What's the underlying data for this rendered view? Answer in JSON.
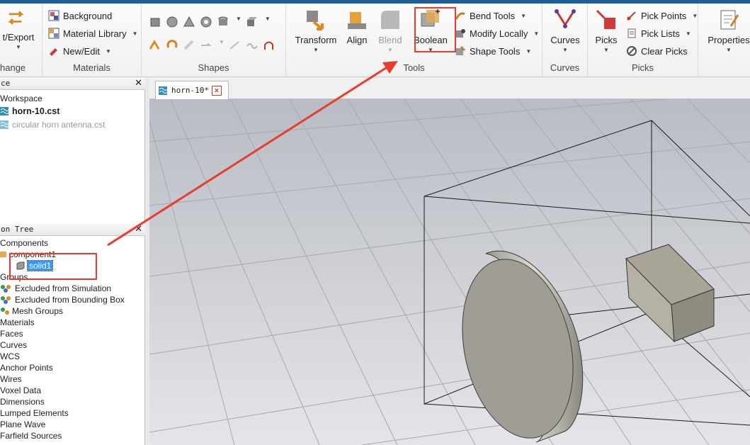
{
  "ribbon": {
    "change_group": {
      "import_export_label": "t/Export",
      "label": "hange"
    },
    "materials_group": {
      "label": "Materials",
      "items": [
        {
          "label": "Background",
          "icon": "background-icon"
        },
        {
          "label": "Material Library",
          "icon": "material-library-icon"
        },
        {
          "label": "New/Edit",
          "icon": "new-edit-icon"
        }
      ]
    },
    "shapes_group": {
      "label": "Shapes"
    },
    "tools_group": {
      "label": "Tools",
      "transform_label": "Transform",
      "align_label": "Align",
      "blend_label": "Blend",
      "boolean_label": "Boolean",
      "items": [
        {
          "label": "Bend Tools"
        },
        {
          "label": "Modify Locally"
        },
        {
          "label": "Shape Tools"
        }
      ]
    },
    "curves_group": {
      "label": "Curves",
      "curves_label": "Curves"
    },
    "picks_group": {
      "label": "Picks",
      "picks_label": "Picks",
      "items": [
        {
          "label": "Pick Points"
        },
        {
          "label": "Pick Lists"
        },
        {
          "label": "Clear Picks"
        }
      ]
    },
    "properties_label": "Properties"
  },
  "workspace_pane": {
    "header": "ce",
    "items": [
      {
        "label": "Workspace"
      },
      {
        "label": "horn-10.cst"
      },
      {
        "label": "circular horn antenna.cst"
      }
    ]
  },
  "navigation_tree": {
    "header": "on Tree",
    "items": [
      {
        "label": "Components"
      },
      {
        "label": "component1"
      },
      {
        "label": "solid1"
      },
      {
        "label": "Groups"
      },
      {
        "label": "Excluded from Simulation"
      },
      {
        "label": "Excluded from Bounding Box"
      },
      {
        "label": "Mesh Groups"
      },
      {
        "label": "Materials"
      },
      {
        "label": "Faces"
      },
      {
        "label": "Curves"
      },
      {
        "label": "WCS"
      },
      {
        "label": "Anchor Points"
      },
      {
        "label": "Wires"
      },
      {
        "label": "Voxel Data"
      },
      {
        "label": "Dimensions"
      },
      {
        "label": "Lumped Elements"
      },
      {
        "label": "Plane Wave"
      },
      {
        "label": "Farfield Sources"
      }
    ]
  },
  "document_tab": {
    "label": "horn-10*",
    "close": "×"
  },
  "colors": {
    "highlight_red": "#e63d2e",
    "selection_blue": "#3399ff",
    "viewport_bg": "#d2d4d9"
  }
}
